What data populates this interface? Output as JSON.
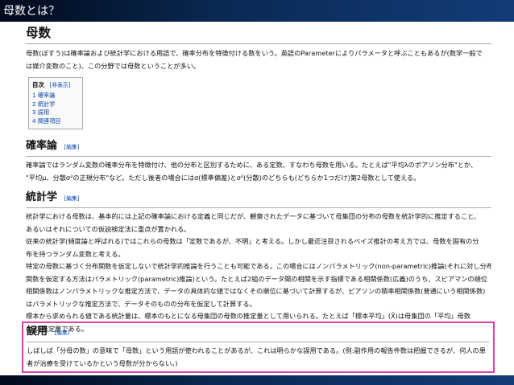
{
  "slide_title": "母数とは？",
  "article": {
    "title": "母数",
    "intro_line1": "母数(ぼすう)は確率論および統計学における用語で、確率分布を特徴付ける数をいう。英語のParameterによりパラメータと呼ぶこともあるが(数学一般で",
    "intro_line2": "は媒介変数のこと)、この分野では母数ということが多い。"
  },
  "toc": {
    "title": "目次",
    "show": "[非表示]",
    "items": [
      "1 確率論",
      "2 統計学",
      "3 誤用",
      "4 関連項目"
    ]
  },
  "sections": {
    "probability": {
      "heading": "確率論",
      "edit": "[編集]",
      "line1": "確率論ではランダム変数の確率分布を特徴付け、他の分布と区別するために、ある定数、すなわち母数を用いる。たとえば\"平均λのポアソン分布\"とか、",
      "line2": "\"平均μ、分散σ²の正規分布\"など。ただし後者の場合にはσ(標準偏差)とσ²(分散)のどちらも(どちらか1つだけ)第2母数として使える。"
    },
    "statistics": {
      "heading": "統計学",
      "edit": "[編集]",
      "line1": "統計学における母数は、基本的には上記の確率論における定義と同じだが、観察されたデータに基づいて母集団の分布の母数を統計学的に推定すること、",
      "line2": "あるいはそれについての仮説検定法に重点が置かれる。",
      "line3": "従来の統計学(頻度論と呼ばれる)ではこれらの母数は「定数であるが、不明」と考える。しかし最近注目されるベイズ推計の考え方では、母数を固有の分",
      "line4": "布を持つランダム変数と考える。",
      "line5": "特定の母数に基づく分布関数を仮定しないで統計学的推論を行うことも可能である。この場合にはノンパラメトリック(non-parametric)推論(それに対し分布",
      "line6": "関数を仮定する方法はパラメトリック(parametric)推論)という。たとえば2組のデータ間の相関を示す指標である相関係数(広義)のうち、スピアマンの順位",
      "line7": "相関係数はノンパラメトリックな推定方法で、データの具体的な値ではなくその順位に基づいて計算するが、ピアソンの積率相関係数(普通にいう相関係数)",
      "line8": "はパラメトリックな推定方法で、データそのものの分布を仮定して計算する。",
      "line9": "標本から求められる値である統計量は、標本のもとになる母集団の母数の推定量として用いられる。たとえば「標本平均」(X̄)は母集団の「平均」母数",
      "line10": "(μ)の推定量である。"
    },
    "misuse": {
      "heading": "誤用",
      "edit": "[編集]",
      "line1": "しばしば「分母の数」の意味で「母数」という用語が使われることがあるが、これは明らかな誤用である。(例:副作用の報告件数は把握できるが、何人の患",
      "line2": "者が治療を受けているかという母数が分からない。)"
    }
  },
  "colors": {
    "link": "#0645ad",
    "highlight_border": "#e040a8",
    "bar_dark": "#020a1c",
    "bar_light": "#123c78"
  }
}
